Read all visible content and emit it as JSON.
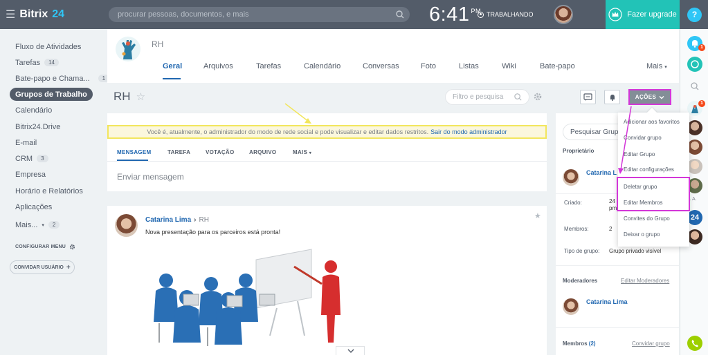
{
  "topbar": {
    "logo": "Bitrix",
    "logo_num": "24",
    "search_placeholder": "procurar pessoas, documentos, e mais",
    "time": "6:41",
    "ampm": "PM",
    "work_status": "TRABALHANDO",
    "upgrade_label": "Fazer upgrade",
    "help": "?"
  },
  "sidebar": {
    "items": [
      {
        "label": "Fluxo de Atividades",
        "count": ""
      },
      {
        "label": "Tarefas",
        "count": "14"
      },
      {
        "label": "Bate-papo e Chama...",
        "count": "1"
      },
      {
        "label": "Grupos de Trabalho",
        "count": ""
      },
      {
        "label": "Calendário",
        "count": ""
      },
      {
        "label": "Bitrix24.Drive",
        "count": ""
      },
      {
        "label": "E-mail",
        "count": ""
      },
      {
        "label": "CRM",
        "count": "3"
      },
      {
        "label": "Empresa",
        "count": ""
      },
      {
        "label": "Horário e Relatórios",
        "count": ""
      },
      {
        "label": "Aplicações",
        "count": ""
      },
      {
        "label": "Mais...",
        "count": "2"
      }
    ],
    "configure_menu": "CONFIGURAR MENU",
    "invite_user": "CONVIDAR USUÁRIO"
  },
  "group": {
    "name": "RH",
    "tabs": [
      "Geral",
      "Arquivos",
      "Tarefas",
      "Calendário",
      "Conversas",
      "Foto",
      "Listas",
      "Wiki",
      "Bate-papo",
      "Mais"
    ]
  },
  "title_bar": {
    "title": "RH",
    "filter_placeholder": "Filtro e pesquisa",
    "actions_label": "AÇÕES"
  },
  "notice": {
    "text": "Você é, atualmente, o administrador do modo de rede social e pode visualizar e editar dados restritos.",
    "link": "Sair do modo administrador"
  },
  "composer": {
    "tabs": [
      "MENSAGEM",
      "TAREFA",
      "VOTAÇÃO",
      "ARQUIVO",
      "MAIS"
    ],
    "placeholder": "Enviar mensagem"
  },
  "post": {
    "author": "Catarina Lima",
    "target": "RH",
    "text": "Nova presentação para os parceiros está pronta!"
  },
  "side_panel": {
    "search_placeholder": "Pesquisar Grupo",
    "owner_label": "Proprietário",
    "owner_name": "Catarina L",
    "created_label": "Criado:",
    "created_value": "24",
    "created_value2": "pm",
    "members_label": "Membros:",
    "members_value": "2",
    "group_type_label": "Tipo de grupo:",
    "group_type_value": "Grupo privado visível",
    "moderators_label": "Moderadores",
    "edit_moderators": "Editar Moderadores",
    "moderator_name": "Catarina Lima",
    "members_title": "Membros",
    "members_count": "(2)",
    "invite_group": "Convidar grupo"
  },
  "dropdown": {
    "items": [
      "Adicionar aos favoritos",
      "Convidar grupo",
      "Editar Grupo",
      "Editar configurações",
      "Deletar grupo",
      "Editar Membros",
      "Convites do Grupo",
      "Deixar o grupo"
    ]
  },
  "rightcol": {
    "notif_badge": "1",
    "avatar_badge": "1",
    "abbr": "G. A.",
    "b24": "24"
  },
  "colors": {
    "topbar": "#535c69",
    "accent": "#2067b0",
    "upgrade": "#22c3b7",
    "highlight": "#d336d8",
    "notice_border": "#f2e65d"
  }
}
